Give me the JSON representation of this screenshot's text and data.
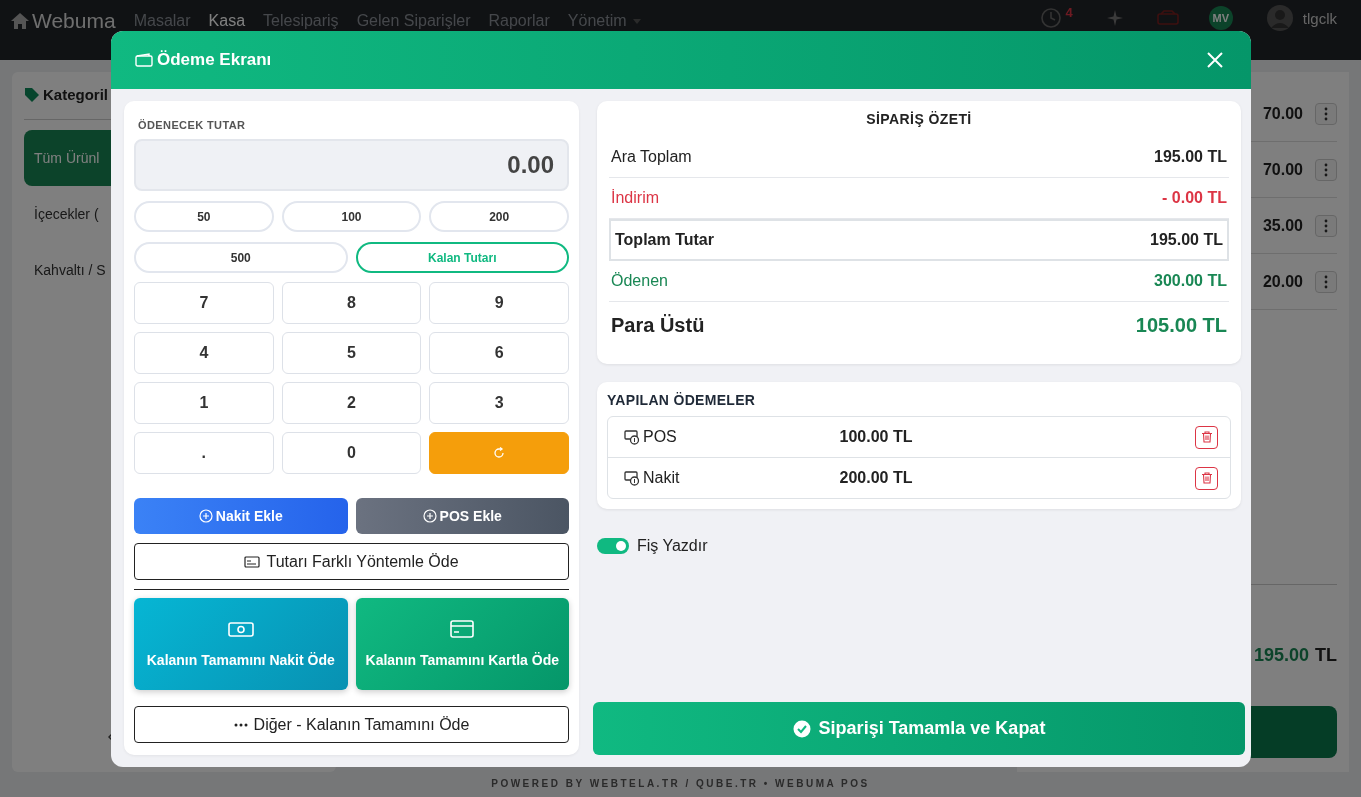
{
  "navbar": {
    "brand": "Webuma",
    "links": [
      {
        "label": "Masalar",
        "selected": false
      },
      {
        "label": "Kasa",
        "selected": true
      },
      {
        "label": "Telesipariş",
        "selected": false
      },
      {
        "label": "Gelen Siparişler",
        "selected": false
      },
      {
        "label": "Raporlar",
        "selected": false
      },
      {
        "label": "Yönetim",
        "selected": false
      }
    ],
    "notification_count": "4",
    "avatar_initials": "MV",
    "username": "tlgclk"
  },
  "background": {
    "category_title": "Kategoril",
    "categories": [
      {
        "label": "Tüm Ürünl",
        "selected": true
      },
      {
        "label": "İçecekler (",
        "selected": false
      },
      {
        "label": "Kahvaltı / S",
        "selected": false
      }
    ],
    "item_prices": [
      "70.00",
      "70.00",
      "35.00",
      "20.00"
    ],
    "total": "195.00",
    "currency": "TL"
  },
  "modal": {
    "title": "Ödeme Ekranı",
    "amount_label": "ÖDENECEK TUTAR",
    "amount": "0.00",
    "quick_amounts": [
      {
        "label": "50",
        "kind": "amount"
      },
      {
        "label": "100",
        "kind": "amount"
      },
      {
        "label": "200",
        "kind": "amount"
      },
      {
        "label": "500",
        "kind": "amount"
      },
      {
        "label": "Kalan Tutarı",
        "kind": "remaining"
      }
    ],
    "keypad": [
      {
        "label": "7",
        "kind": "key"
      },
      {
        "label": "8",
        "kind": "key"
      },
      {
        "label": "9",
        "kind": "key"
      },
      {
        "label": "4",
        "kind": "key"
      },
      {
        "label": "5",
        "kind": "key"
      },
      {
        "label": "6",
        "kind": "key"
      },
      {
        "label": "1",
        "kind": "key"
      },
      {
        "label": "2",
        "kind": "key"
      },
      {
        "label": "3",
        "kind": "key"
      },
      {
        "label": ".",
        "kind": "key"
      },
      {
        "label": "0",
        "kind": "key"
      },
      {
        "kind": "reset"
      }
    ],
    "add_cash": "Nakit Ekle",
    "add_pos": "POS Ekle",
    "split": "Tutarı Farklı Yöntemle Öde",
    "pay_all_cash": "Kalanın Tamamını Nakit Öde",
    "pay_all_card": "Kalanın Tamamını Kartla Öde",
    "other": "Diğer - Kalanın Tamamını Öde",
    "summary": {
      "title": "SİPARİŞ ÖZETİ",
      "rows": [
        {
          "label": "Ara Toplam",
          "value": "195.00 TL",
          "kind": "normal"
        },
        {
          "label": "İndirim",
          "value": "- 0.00 TL",
          "kind": "discount"
        },
        {
          "label": "Toplam Tutar",
          "value": "195.00 TL",
          "kind": "total"
        },
        {
          "label": "Ödenen",
          "value": "300.00 TL",
          "kind": "paid"
        },
        {
          "label": "Para Üstü",
          "value": "105.00 TL",
          "kind": "change"
        }
      ]
    },
    "payments": {
      "title": "YAPILAN ÖDEMELER",
      "items": [
        {
          "method": "POS",
          "amount": "100.00 TL"
        },
        {
          "method": "Nakit",
          "amount": "200.00 TL"
        }
      ]
    },
    "print_receipt": {
      "label": "Fiş Yazdır",
      "on": true
    },
    "complete": "Siparişi Tamamla ve Kapat"
  },
  "footer": "POWERED BY WEBTELA.TR / QUBE.TR • WEBUMA POS"
}
